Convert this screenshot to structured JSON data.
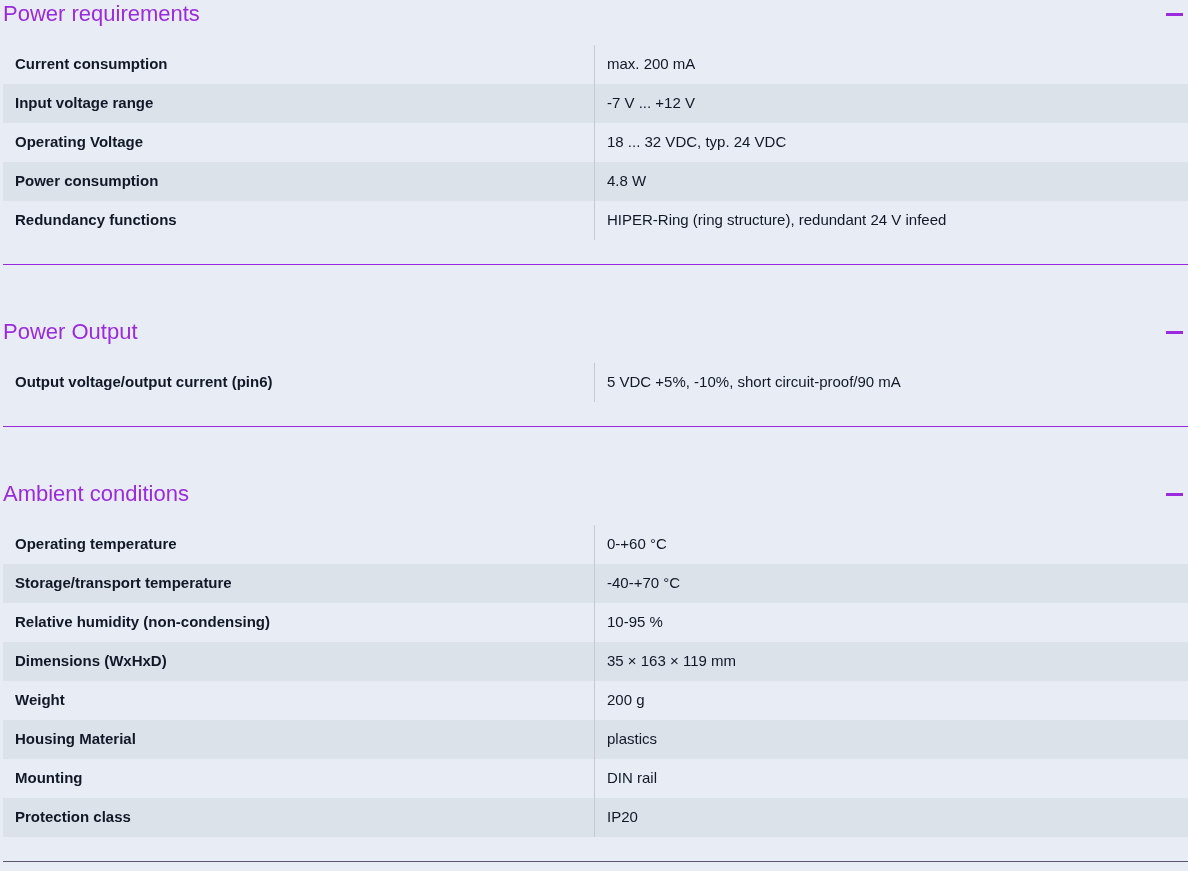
{
  "sections": [
    {
      "title": "Power requirements",
      "expanded": true,
      "rows": [
        {
          "label": "Current consumption",
          "value": "max. 200 mA"
        },
        {
          "label": "Input voltage range",
          "value": "-7 V ... +12 V"
        },
        {
          "label": "Operating Voltage",
          "value": "18 ... 32 VDC, typ. 24 VDC"
        },
        {
          "label": "Power consumption",
          "value": "4.8 W"
        },
        {
          "label": "Redundancy functions",
          "value": "HIPER-Ring (ring structure), redundant 24 V infeed"
        }
      ]
    },
    {
      "title": "Power Output",
      "expanded": true,
      "rows": [
        {
          "label": "Output voltage/output current (pin6)",
          "value": "5 VDC +5%, -10%, short circuit-proof/90 mA"
        }
      ]
    },
    {
      "title": "Ambient conditions",
      "expanded": true,
      "rows": [
        {
          "label": "Operating temperature",
          "value": "0-+60 °C"
        },
        {
          "label": "Storage/transport temperature",
          "value": "-40-+70 °C"
        },
        {
          "label": "Relative humidity (non-condensing)",
          "value": "10-95 %"
        },
        {
          "label": "Dimensions (WxHxD)",
          "value": "35 × 163 × 119 mm"
        },
        {
          "label": "Weight",
          "value": "200 g"
        },
        {
          "label": "Housing Material",
          "value": "plastics"
        },
        {
          "label": "Mounting",
          "value": "DIN rail"
        },
        {
          "label": "Protection class",
          "value": "IP20"
        }
      ]
    }
  ]
}
